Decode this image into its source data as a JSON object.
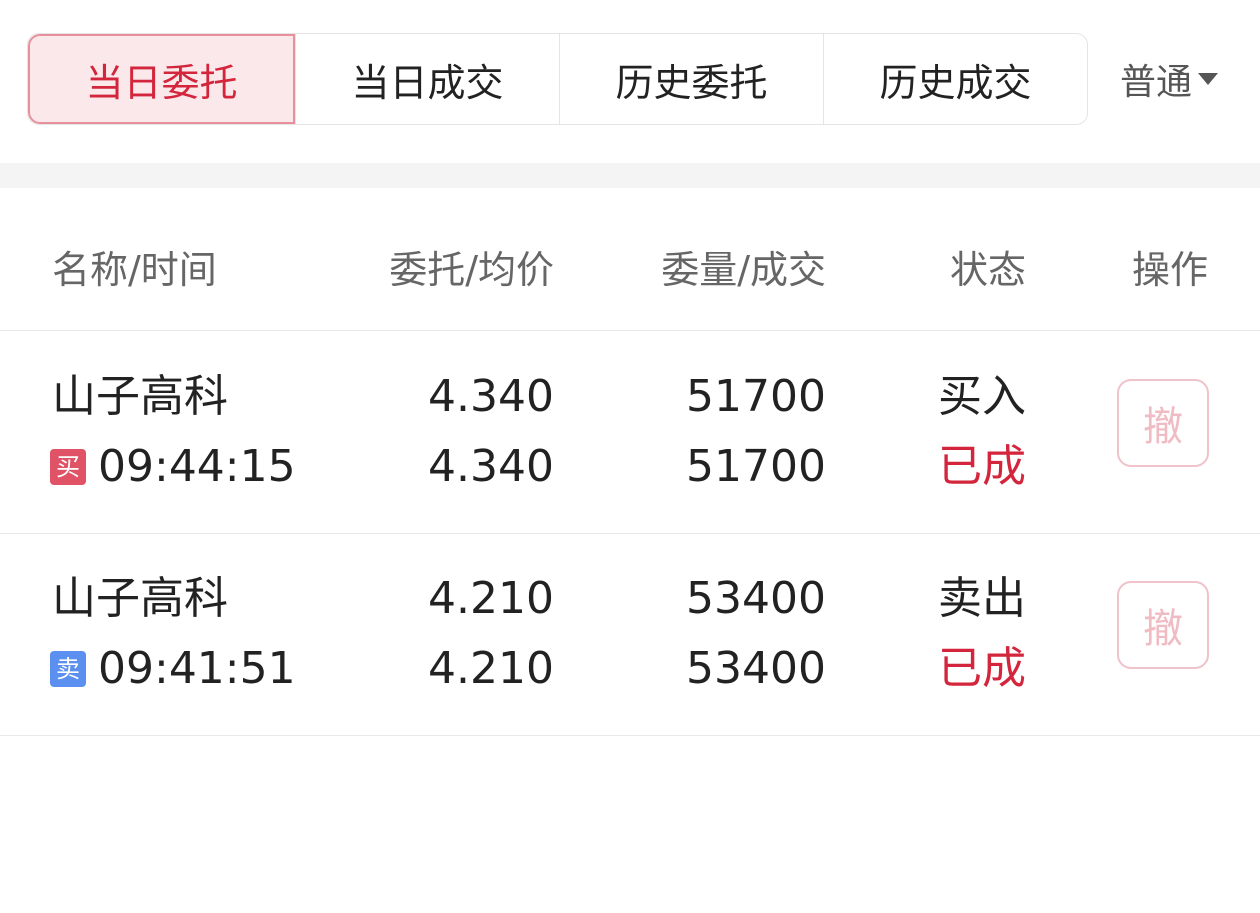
{
  "tabs": [
    {
      "label": "当日委托",
      "active": true
    },
    {
      "label": "当日成交",
      "active": false
    },
    {
      "label": "历史委托",
      "active": false
    },
    {
      "label": "历史成交",
      "active": false
    }
  ],
  "mode_select": {
    "label": "普通",
    "icon": "caret-down-icon"
  },
  "table": {
    "headers": {
      "name_time": "名称/时间",
      "price": "委托/均价",
      "qty": "委量/成交",
      "status": "状态",
      "operation": "操作"
    },
    "rows": [
      {
        "name": "山子高科",
        "side_badge": "买",
        "side_type": "buy",
        "time": "09:44:15",
        "order_price": "4.340",
        "avg_price": "4.340",
        "order_qty": "51700",
        "filled_qty": "51700",
        "direction": "买入",
        "status": "已成",
        "cancel_label": "撤"
      },
      {
        "name": "山子高科",
        "side_badge": "卖",
        "side_type": "sell",
        "time": "09:41:51",
        "order_price": "4.210",
        "avg_price": "4.210",
        "order_qty": "53400",
        "filled_qty": "53400",
        "direction": "卖出",
        "status": "已成",
        "cancel_label": "撤"
      }
    ]
  },
  "colors": {
    "accent_red": "#d3263c",
    "active_tab_bg": "#fbe8ea",
    "buy_badge": "#e05366",
    "sell_badge": "#5b8ff0",
    "cancel_disabled": "#f0bcc4"
  }
}
